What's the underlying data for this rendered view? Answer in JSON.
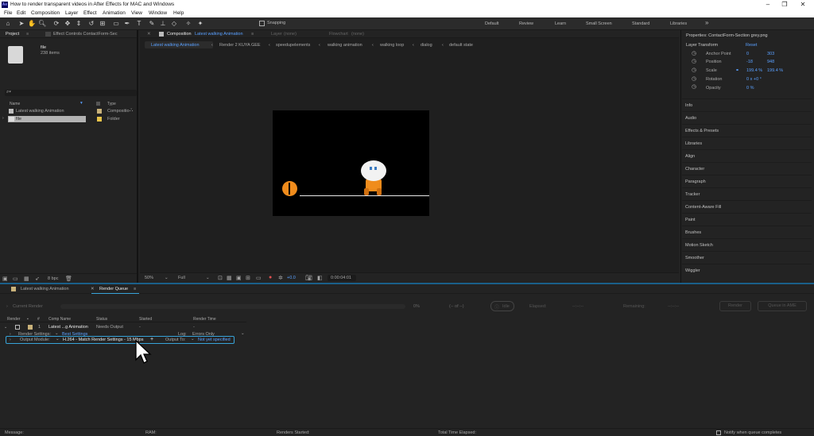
{
  "window": {
    "title": "How to render transparent videos in After Effects for MAC and Windows",
    "app_icon": "Ae"
  },
  "menu": [
    "File",
    "Edit",
    "Composition",
    "Layer",
    "Effect",
    "Animation",
    "View",
    "Window",
    "Help"
  ],
  "toolbar": {
    "snapping": "Snapping",
    "workspaces": [
      "Default",
      "Review",
      "Learn",
      "Small Screen",
      "Standard",
      "Libraries"
    ],
    "overflow": "»"
  },
  "project": {
    "tab_project": "Project",
    "tab_effect": "Effect Controls ContactForm-Sec",
    "item_name": "file",
    "item_sub": "238 items",
    "search_icon": "⌕▾",
    "columns": [
      "Name",
      "Type"
    ],
    "rows": [
      {
        "name": "Latest walking Animation",
        "type": "Compositio"
      },
      {
        "name": "file",
        "type": "Folder"
      }
    ],
    "bpc": "8 bpc"
  },
  "composition": {
    "tab_comp": "Composition",
    "tab_comp_name": "Latest walking Animation",
    "tab_layer": "Layer",
    "tab_layer_val": "(none)",
    "tab_flow": "Flowchart",
    "tab_flow_val": "(none)",
    "breadcrumbs": [
      "Latest walking Animation",
      "Render 2 KUYA GEE",
      "speedupelements",
      "walking animation",
      "walking loop",
      "dialog",
      "default state"
    ],
    "zoom": "50%",
    "resolution": "Full",
    "exposure": "+0.0",
    "timecode": "0:00:04:01"
  },
  "properties": {
    "title": "Properties: ContactForm-Section grey.png",
    "section": "Layer Transform",
    "reset": "Reset",
    "rows": [
      {
        "label": "Anchor Point",
        "v1": "0",
        "v2": "303"
      },
      {
        "label": "Position",
        "v1": "-18",
        "v2": "948"
      },
      {
        "label": "Scale",
        "v1": "199.4 %",
        "v2": "199.4 %"
      },
      {
        "label": "Rotation",
        "v1": "0 x +0 °",
        "v2": ""
      },
      {
        "label": "Opacity",
        "v1": "0 %",
        "v2": ""
      }
    ],
    "panels": [
      "Info",
      "Audio",
      "Effects & Presets",
      "Libraries",
      "Align",
      "Character",
      "Paragraph",
      "Tracker",
      "Content-Aware Fill",
      "Paint",
      "Brushes",
      "Motion Sketch",
      "Smoother",
      "Wiggler"
    ]
  },
  "render_queue": {
    "tab_timeline": "Latest walking Animation",
    "tab_rq": "Render Queue",
    "current_render": "Current Render",
    "percent": "0%",
    "of_text": "(-- of --)",
    "idle": "Idle",
    "elapsed_label": "Elapsed:",
    "elapsed_val": "--:--:--",
    "remaining_label": "Remaining:",
    "remaining_val": "--:--:--",
    "btn_render": "Render",
    "btn_ame": "Queue in AME",
    "columns": [
      "Render",
      "#",
      "Comp Name",
      "Status",
      "Started",
      "Render Time"
    ],
    "row": {
      "num": "1",
      "comp": "Latest ...g Animation",
      "status": "Needs Output",
      "started": "-",
      "time": "-"
    },
    "render_settings_label": "Render Settings:",
    "render_settings_val": "Best Settings",
    "log_label": "Log:",
    "log_val": "Errors Only",
    "output_module_label": "Output Module:",
    "output_module_val": "H.264 - Match Render Settings - 15 Mbps",
    "add": "+",
    "output_to_label": "Output To:",
    "output_to_val": "Not yet specified"
  },
  "status_bar": {
    "message": "Message:",
    "ram": "RAM:",
    "renders_started": "Renders Started:",
    "total_time": "Total Time Elapsed:",
    "notify": "Notify when queue completes"
  },
  "colors": {
    "accent": "#37a3d9",
    "link": "#5aa0ff",
    "label_yellow": "#e8c44a",
    "label_tan": "#c9b27a"
  }
}
